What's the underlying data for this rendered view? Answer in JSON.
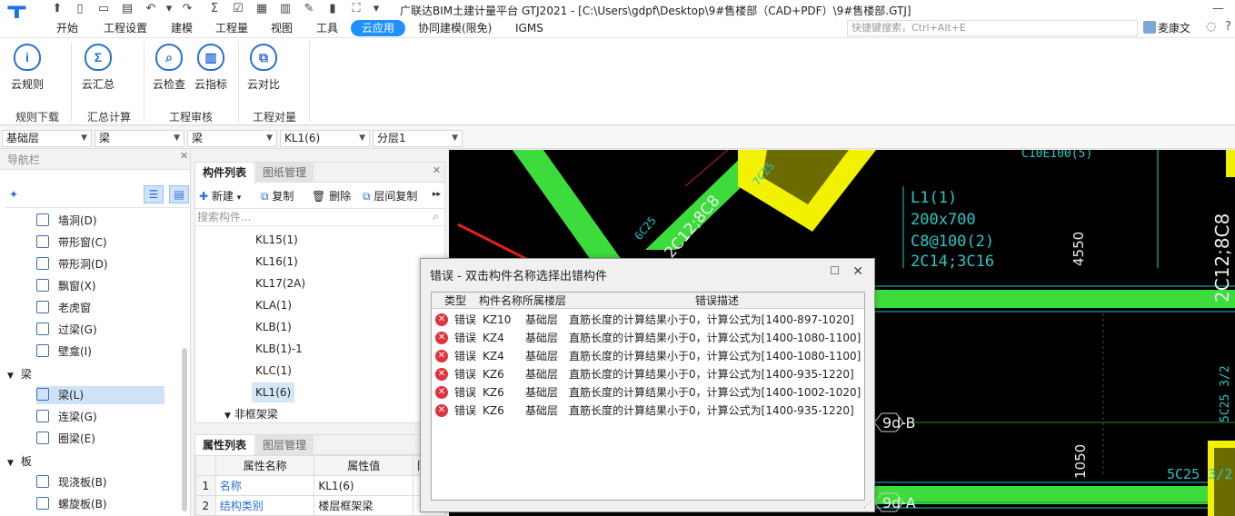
{
  "app": {
    "title": "广联达BIM土建计量平台 GTJ2021 - [C:\\Users\\gdpf\\Desktop\\9#售楼部（CAD+PDF）\\9#售楼部.GTJ]",
    "logo_letter": "T"
  },
  "menu": [
    "开始",
    "工程设置",
    "建模",
    "工程量",
    "视图",
    "工具",
    "云应用",
    "协同建模(限免)",
    "IGMS"
  ],
  "search_placeholder": "快捷键搜索，Ctrl+Alt+E",
  "user_name": "麦康文",
  "ribbon": {
    "buttons": [
      {
        "label": "云规则",
        "icon": "info-icon",
        "glyph": "i"
      },
      {
        "label": "云汇总",
        "icon": "sum-icon",
        "glyph": "Σ"
      },
      {
        "label": "云检查",
        "icon": "search-icon",
        "glyph": "⌕"
      },
      {
        "label": "云指标",
        "icon": "chart-icon",
        "glyph": "▥"
      },
      {
        "label": "云对比",
        "icon": "compare-icon",
        "glyph": "⧉"
      }
    ],
    "groups": [
      "规则下载",
      "汇总计算",
      "工程审核",
      "工程对量"
    ]
  },
  "selectors": [
    "基础层",
    "梁",
    "梁",
    "KL1(6)",
    "分层1"
  ],
  "nav": {
    "title": "导航栏",
    "items": [
      {
        "label": "墙洞(D)"
      },
      {
        "label": "带形窗(C)"
      },
      {
        "label": "带形洞(D)"
      },
      {
        "label": "飘窗(X)"
      },
      {
        "label": "老虎窗"
      },
      {
        "label": "过梁(G)"
      },
      {
        "label": "壁龛(I)"
      }
    ],
    "group_beam": "梁",
    "beam_items": [
      {
        "label": "梁(L)"
      },
      {
        "label": "连梁(G)"
      },
      {
        "label": "圈梁(E)"
      }
    ],
    "group_slab": "板",
    "slab_items": [
      {
        "label": "现浇板(B)"
      },
      {
        "label": "螺旋板(B)"
      }
    ]
  },
  "components": {
    "tab_active": "构件列表",
    "tab_other": "图纸管理",
    "toolbar": {
      "new": "新建",
      "copy": "复制",
      "delete": "删除",
      "floor_copy": "层间复制"
    },
    "search_placeholder": "搜索构件...",
    "items": [
      "KL15(1)",
      "KL16(1)",
      "KL17(2A)",
      "KLA(1)",
      "KLB(1)",
      "KLB(1)-1",
      "KLC(1)",
      "KL1(6)"
    ],
    "selected": "KL1(6)",
    "group_nonframe": "非框架梁"
  },
  "properties": {
    "tab_active": "属性列表",
    "tab_other": "图层管理",
    "headers": [
      "属性名称",
      "属性值",
      "附加"
    ],
    "rows": [
      {
        "no": "1",
        "name": "名称",
        "value": "KL1(6)"
      },
      {
        "no": "2",
        "name": "结构类别",
        "value": "楼层框架梁"
      }
    ]
  },
  "canvas": {
    "labels": [
      "C10E100(5)",
      "L1(1)",
      "200x700",
      "C8@100(2)",
      "2C14;3C16",
      "4550",
      "2C12;8C8",
      "9d-B",
      "1050",
      "9d-A",
      "5C25 3/2",
      "2C12;8C8",
      "6C25",
      "7C25",
      "5C25 3/2"
    ]
  },
  "dialog": {
    "title": "错误 - 双击构件名称选择出错构件",
    "headers": [
      "类型",
      "构件名称",
      "所属楼层",
      "错误描述"
    ],
    "rows": [
      {
        "type": "错误",
        "name": "KZ10",
        "floor": "基础层",
        "desc": "直筋长度的计算结果小于0，计算公式为[1400-897-1020]"
      },
      {
        "type": "错误",
        "name": "KZ4",
        "floor": "基础层",
        "desc": "直筋长度的计算结果小于0，计算公式为[1400-1080-1100]"
      },
      {
        "type": "错误",
        "name": "KZ4",
        "floor": "基础层",
        "desc": "直筋长度的计算结果小于0，计算公式为[1400-1080-1100]"
      },
      {
        "type": "错误",
        "name": "KZ6",
        "floor": "基础层",
        "desc": "直筋长度的计算结果小于0，计算公式为[1400-935-1220]"
      },
      {
        "type": "错误",
        "name": "KZ6",
        "floor": "基础层",
        "desc": "直筋长度的计算结果小于0，计算公式为[1400-1002-1020]"
      },
      {
        "type": "错误",
        "name": "KZ6",
        "floor": "基础层",
        "desc": "直筋长度的计算结果小于0，计算公式为[1400-935-1220]"
      }
    ]
  },
  "colors": {
    "accent": "#1e90ff",
    "beam_green": "#3ddc3d",
    "highlight_yellow": "#f2f200",
    "cad_cyan": "#27c7c7",
    "error_red": "#e0333e"
  }
}
